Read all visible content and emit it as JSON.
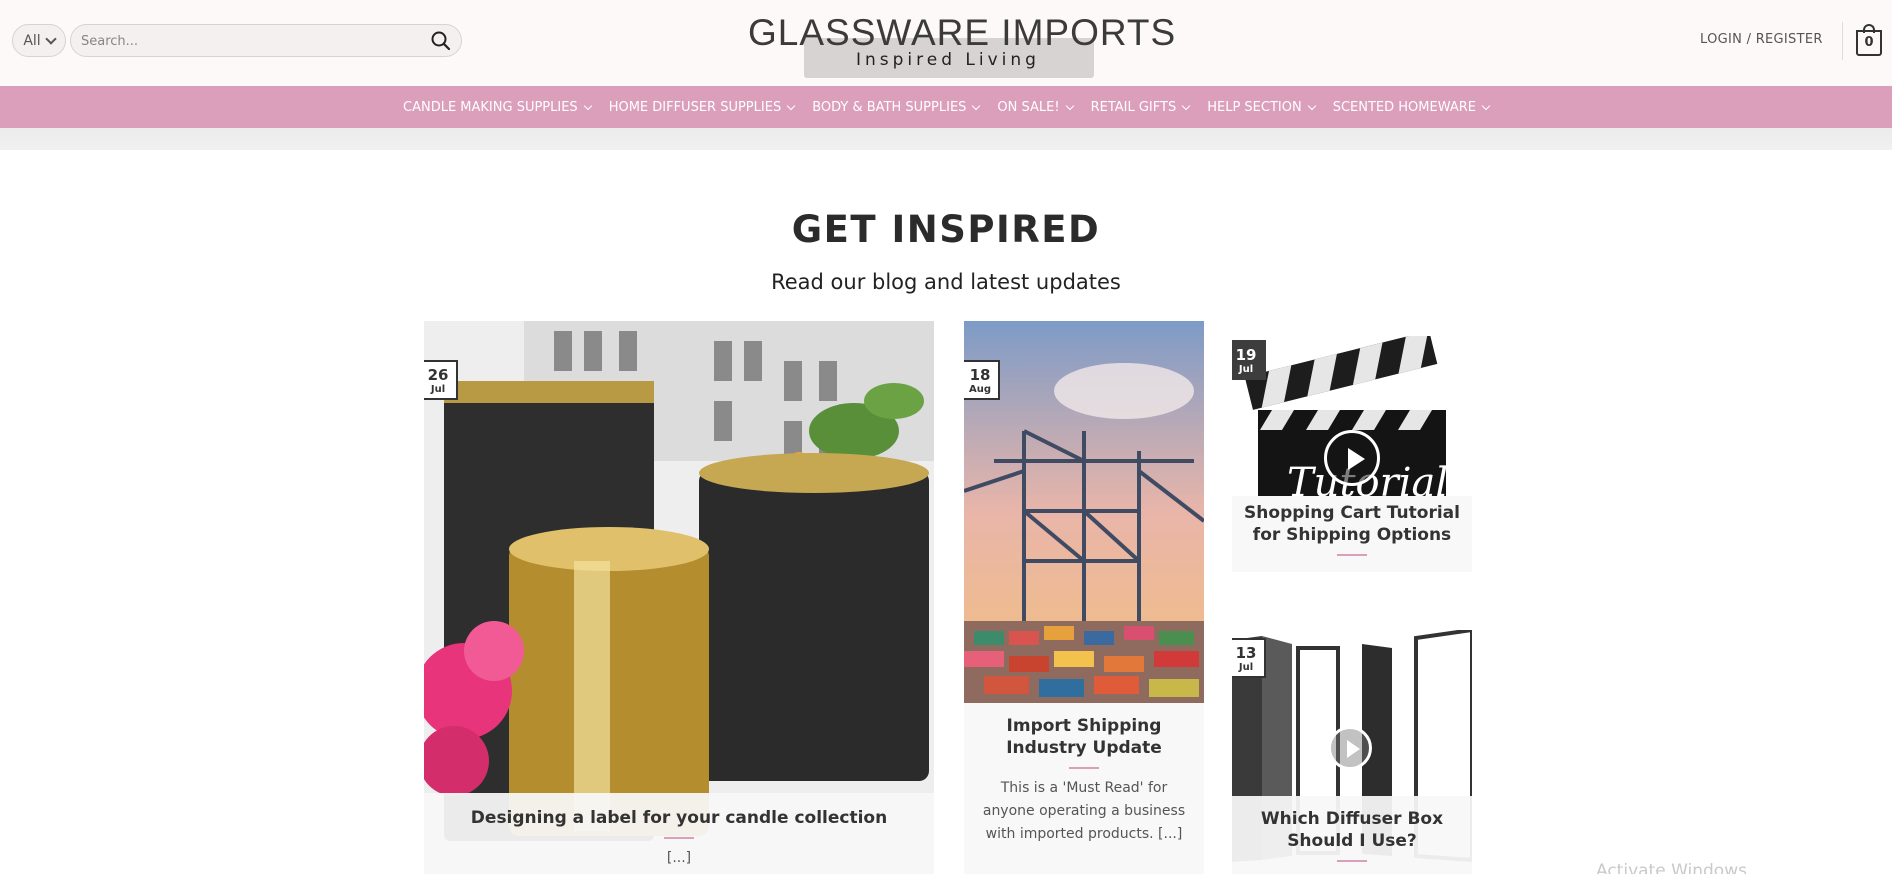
{
  "header": {
    "category_select": "All",
    "search_placeholder": "Search...",
    "logo_title": "GLASSWARE IMPORTS",
    "logo_tagline": "Inspired Living",
    "login_label": "LOGIN / REGISTER",
    "cart_count": "0"
  },
  "nav": {
    "items": [
      {
        "label": "CANDLE MAKING SUPPLIES"
      },
      {
        "label": "HOME DIFFUSER SUPPLIES"
      },
      {
        "label": "BODY & BATH SUPPLIES"
      },
      {
        "label": "ON SALE!"
      },
      {
        "label": "RETAIL GIFTS"
      },
      {
        "label": "HELP SECTION"
      },
      {
        "label": "SCENTED HOMEWARE"
      }
    ]
  },
  "section": {
    "title": "GET INSPIRED",
    "subtitle": "Read our blog and latest updates"
  },
  "posts": [
    {
      "day": "26",
      "month": "Jul",
      "title": "Designing a label for your candle collection",
      "excerpt": "[...]",
      "image": "candle-jars-photo"
    },
    {
      "day": "18",
      "month": "Aug",
      "title": "Import Shipping Industry Update",
      "excerpt": "This is a 'Must Read' for anyone operating a business with imported products. [...]",
      "image": "shipping-port-photo"
    },
    {
      "day": "19",
      "month": "Jul",
      "title": "Shopping Cart Tutorial for Shipping Options",
      "excerpt": "",
      "image": "tutorial-clapperboard-photo",
      "badge_style": "dark"
    },
    {
      "day": "13",
      "month": "Jul",
      "title": "Which Diffuser Box Should I Use?",
      "excerpt": "",
      "image": "diffuser-boxes-photo"
    }
  ],
  "overlay_text": "Activate Windows",
  "colors": {
    "nav_bg": "#db9fbc",
    "accent_line": "#db9fbc",
    "header_bg": "#fcf9f8"
  }
}
